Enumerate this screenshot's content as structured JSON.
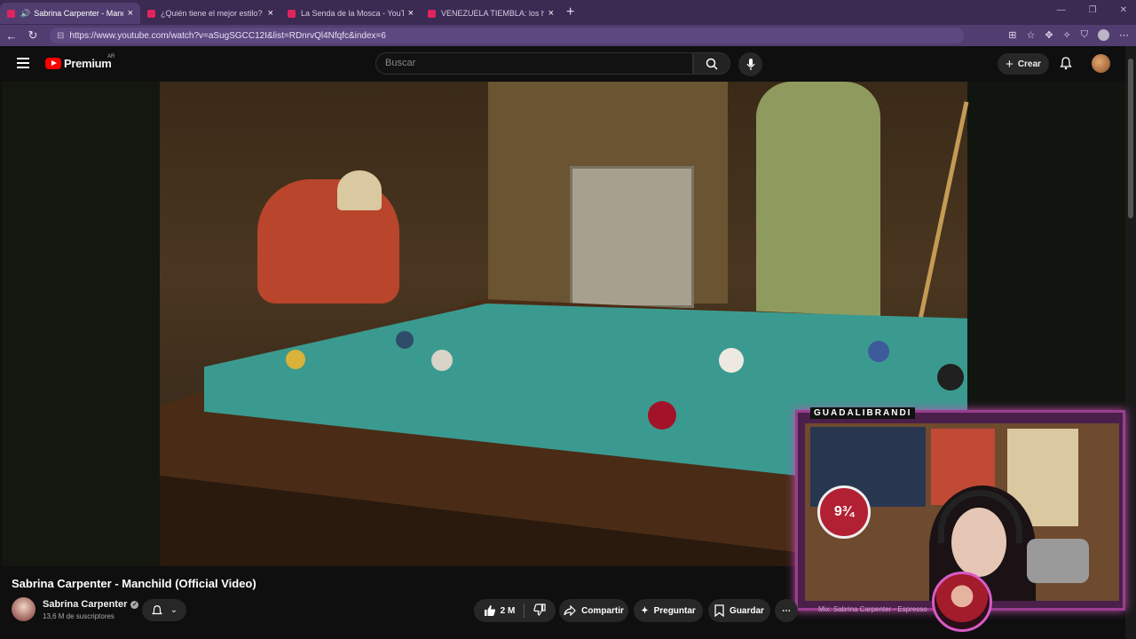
{
  "browser": {
    "tabs": [
      {
        "title": "Sabrina Carpenter - Manchild",
        "active": true
      },
      {
        "title": "¿Quién tiene el mejor estilo? Lit K",
        "active": false
      },
      {
        "title": "La Senda de la Mosca - YouTube",
        "active": false
      },
      {
        "title": "VENEZUELA TIEMBLA: los héroes",
        "active": false
      }
    ],
    "url": "https://www.youtube.com/watch?v=aSugSGCC12I&list=RDnrvQl4Nfqfc&index=6"
  },
  "youtube": {
    "logo_text": "Premium",
    "country_code": "AR",
    "search_placeholder": "Buscar",
    "create_label": "Crear"
  },
  "video": {
    "title": "Sabrina Carpenter - Manchild (Official Video)",
    "channel_name": "Sabrina Carpenter",
    "subscribers": "13,6 M de suscriptores",
    "likes": "2 M",
    "share_label": "Compartir",
    "ask_label": "Preguntar",
    "save_label": "Guardar"
  },
  "overlay": {
    "streamer_name": "GUADALIBRANDI",
    "badge_text": "9¾",
    "ticker_text": "Mix: Sabrina Carpenter - Espresso"
  },
  "colors": {
    "tabbar": "#3b2a52",
    "addressbar": "#523d70",
    "brand_red": "#ff0000",
    "overlay_border": "#9a3f8e"
  }
}
